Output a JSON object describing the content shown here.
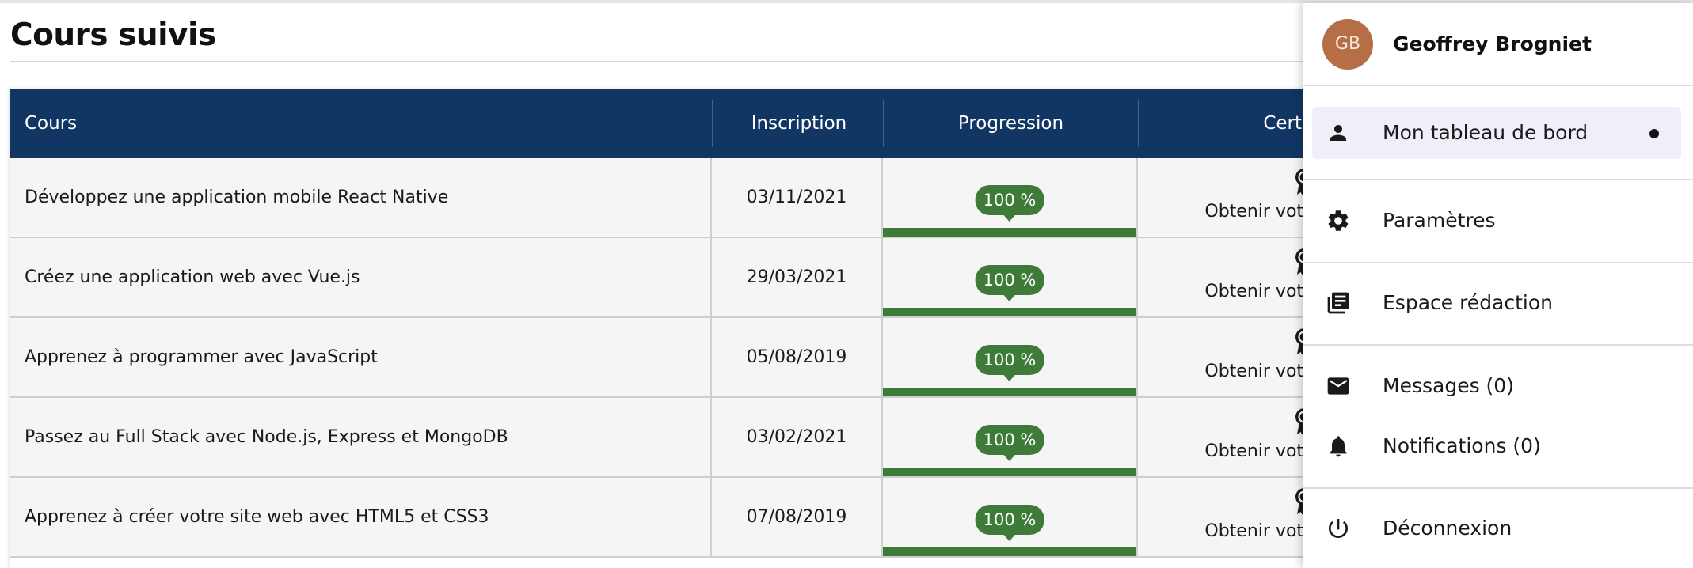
{
  "page": {
    "title": "Cours suivis"
  },
  "table": {
    "headers": {
      "course": "Cours",
      "inscription": "Inscription",
      "progression": "Progression",
      "certificate": "Certificat"
    },
    "rows": [
      {
        "course": "Développez une application mobile React Native",
        "date": "03/11/2021",
        "progress_label": "100 %",
        "progress": 100,
        "certificate": "Obtenir votre certificat"
      },
      {
        "course": "Créez une application web avec Vue.js",
        "date": "29/03/2021",
        "progress_label": "100 %",
        "progress": 100,
        "certificate": "Obtenir votre certificat"
      },
      {
        "course": "Apprenez à programmer avec JavaScript",
        "date": "05/08/2019",
        "progress_label": "100 %",
        "progress": 100,
        "certificate": "Obtenir votre certificat"
      },
      {
        "course": "Passez au Full Stack avec Node.js, Express et MongoDB",
        "date": "03/02/2021",
        "progress_label": "100 %",
        "progress": 100,
        "certificate": "Obtenir votre certificat"
      },
      {
        "course": "Apprenez à créer votre site web avec HTML5 et CSS3",
        "date": "07/08/2019",
        "progress_label": "100 %",
        "progress": 100,
        "certificate": "Obtenir votre certificat"
      }
    ]
  },
  "user_menu": {
    "avatar_initials": "GB",
    "user_name": "Geoffrey Brogniet",
    "items": [
      {
        "label": "Mon tableau de bord",
        "icon": "person-icon",
        "active": true
      },
      {
        "label": "Paramètres",
        "icon": "gear-icon"
      },
      {
        "label": "Espace rédaction",
        "icon": "library-books-icon"
      },
      {
        "label": "Messages (0)",
        "icon": "mail-icon"
      },
      {
        "label": "Notifications (0)",
        "icon": "bell-icon"
      },
      {
        "label": "Déconnexion",
        "icon": "power-icon"
      }
    ]
  },
  "colors": {
    "header_bg": "#113664",
    "progress_green": "#3e7b39",
    "avatar_bg": "#b66e46",
    "active_item_bg": "#f1eef9"
  }
}
